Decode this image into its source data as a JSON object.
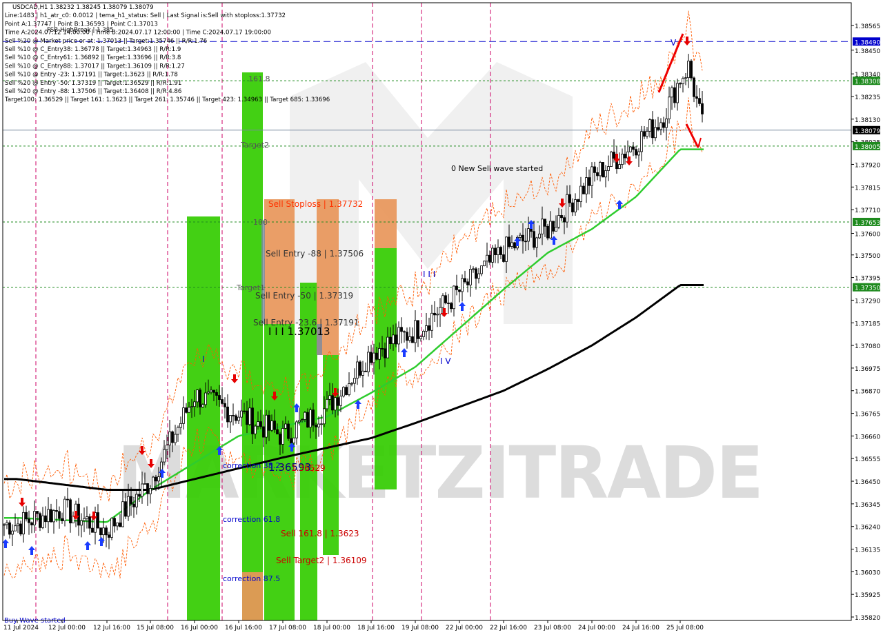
{
  "header_lines": [
    "USDCAD,H1  1.38232 1.38245 1.38079 1.38079",
    "Line:1483  |  h1_atr_c0: 0.0012  |  tema_h1_status: Sell  |  Last Signal is:Sell with stoploss:1.37732",
    "Point A:1.37747  |  Point B:1.36593  |  Point C:1.37013",
    "Time A:2024.07.12 14:00:00  |  Time B:2024.07.17 12:00:00  |  Time C:2024.07.17 19:00:00",
    "Sell %20 @ Market price or at: 1.37013  ||  Target:1.35746  ||  R/R:1.76",
    "Sell %10 @ C_Entry38: 1.36778  ||  Target:1.34963  ||  R/R:1.9",
    "Sell %10 @ C_Entry61: 1.36892  ||  Target:1.33696  ||  R/R:3.8",
    "Sell %10 @ C_Entry88: 1.37017  ||  Target:1.36109  ||  R/R:1.27",
    "Sell %10 @ Entry -23: 1.37191  ||  Target:1.3623  ||  R/R:1.78",
    "Sell %20 @ Entry -50: 1.37319  ||  Target:1.36529  ||  R/R:1.91",
    "Sell %20 @ Entry -88: 1.37506  ||  Target:1.36408  ||  R/R:4.86",
    "Target100: 1.36529  ||  Target 161: 1.3623  ||  Target 261: 1.35746  ||  Target 423: 1.34963  ||  Target 685: 1.33696"
  ],
  "overlay_label": "FSB-HighBreak | 1.385",
  "colors": {
    "background": "#ffffff",
    "bull_candle": "#000000",
    "bear_candle": "#000000",
    "ma_fast": "#2ecc2e",
    "ma_slow": "#000000",
    "band": "#ff5a00",
    "level_green": "#1e8a1e",
    "level_blue": "#0000cc",
    "vline": "#cc0066",
    "zone_green": "#33cc00",
    "zone_orange": "#e8965a",
    "arrow_up": "#1a3cff",
    "arrow_down": "#e60000"
  },
  "chart_data": {
    "type": "candlestick",
    "symbol": "USDCAD",
    "timeframe": "H1",
    "ohlc_last": {
      "open": 1.38232,
      "high": 1.38245,
      "low": 1.38079,
      "close": 1.38079
    },
    "y_range": [
      1.3582,
      1.3859
    ],
    "y_ticks": [
      1.38565,
      1.3845,
      1.3834,
      1.38235,
      1.3813,
      1.38025,
      1.3792,
      1.37815,
      1.3771,
      1.376,
      1.375,
      1.37395,
      1.3729,
      1.37185,
      1.3708,
      1.36975,
      1.3687,
      1.36765,
      1.3666,
      1.36555,
      1.3645,
      1.36345,
      1.3624,
      1.36135,
      1.3603,
      1.35925,
      1.3582
    ],
    "x_labels": [
      "11 Jul 2024",
      "12 Jul 00:00",
      "12 Jul 16:00",
      "15 Jul 08:00",
      "16 Jul 00:00",
      "16 Jul 16:00",
      "17 Jul 08:00",
      "18 Jul 00:00",
      "18 Jul 16:00",
      "19 Jul 08:00",
      "22 Jul 00:00",
      "22 Jul 16:00",
      "23 Jul 08:00",
      "24 Jul 00:00",
      "24 Jul 16:00",
      "25 Jul 08:00"
    ],
    "horizontal_levels": [
      {
        "value": 1.3849,
        "label": "1.38490",
        "style": "dashed",
        "color": "blue"
      },
      {
        "value": 1.38308,
        "label": "1.38308",
        "style": "dotted",
        "color": "green"
      },
      {
        "value": 1.38079,
        "label": "1.38079",
        "style": "solid",
        "color": "gray"
      },
      {
        "value": 1.38005,
        "label": "1.38005",
        "style": "dotted",
        "color": "green"
      },
      {
        "value": 1.37653,
        "label": "1.37653",
        "style": "dotted",
        "color": "green"
      },
      {
        "value": 1.3735,
        "label": "1.37350",
        "style": "dotted",
        "color": "green"
      }
    ],
    "annotations": [
      {
        "text": "0 New Sell wave started",
        "color": "#000000"
      },
      {
        "text": "Sell Stoploss | 1.37732",
        "color": "#ff3300"
      },
      {
        "text": "Sell Entry -88 | 1.37506",
        "color": "#333333"
      },
      {
        "text": "Sell Entry -50 | 1.37319",
        "color": "#333333"
      },
      {
        "text": "Sell Entry -23.6 | 1.37191",
        "color": "#333333"
      },
      {
        "text": "I I I 1.37013",
        "color": "#000000"
      },
      {
        "text": "1.36593",
        "color": "#000080"
      },
      {
        "text": "correction 38.2",
        "color": "#0000cc"
      },
      {
        "text": "1.36529",
        "color": "#cc0000"
      },
      {
        "text": "correction 61.8",
        "color": "#0000cc"
      },
      {
        "text": "Sell 161.8 | 1.3623",
        "color": "#cc0000"
      },
      {
        "text": "Sell Target2 | 1.36109",
        "color": "#cc0000"
      },
      {
        "text": "correction 87.5",
        "color": "#0000cc"
      },
      {
        "text": "161.8",
        "color": "#555555"
      },
      {
        "text": "100",
        "color": "#555555"
      },
      {
        "text": "Target2",
        "color": "#555555"
      },
      {
        "text": "Target1",
        "color": "#555555"
      },
      {
        "text": "I I I",
        "color": "#0000cc"
      },
      {
        "text": "I V",
        "color": "#0000cc"
      },
      {
        "text": "V",
        "color": "#0000cc"
      },
      {
        "text": "I",
        "color": "#0000cc"
      },
      {
        "text": "Buy Wave started",
        "color": "#0000cc"
      }
    ],
    "watermark": "MARKETZITRADE",
    "price_anchor_points": [
      {
        "x": "11 Jul 2024",
        "y": 1.3625
      },
      {
        "x": "12 Jul 00:00",
        "y": 1.3632
      },
      {
        "x": "12 Jul 16:00",
        "y": 1.3622
      },
      {
        "x": "15 Jul 08:00",
        "y": 1.3645
      },
      {
        "x": "16 Jul 00:00",
        "y": 1.3685
      },
      {
        "x": "16 Jul 16:00",
        "y": 1.3676
      },
      {
        "x": "17 Jul 08:00",
        "y": 1.3666
      },
      {
        "x": "18 Jul 00:00",
        "y": 1.3679
      },
      {
        "x": "18 Jul 16:00",
        "y": 1.3705
      },
      {
        "x": "19 Jul 08:00",
        "y": 1.3715
      },
      {
        "x": "22 Jul 00:00",
        "y": 1.3733
      },
      {
        "x": "22 Jul 16:00",
        "y": 1.3752
      },
      {
        "x": "23 Jul 08:00",
        "y": 1.3762
      },
      {
        "x": "24 Jul 00:00",
        "y": 1.3786
      },
      {
        "x": "24 Jul 16:00",
        "y": 1.3802
      },
      {
        "x": "25 Jul 08:00",
        "y": 1.3821
      }
    ],
    "ma_fast_anchors": [
      {
        "x": "11 Jul 2024",
        "y": 1.3628
      },
      {
        "x": "12 Jul 16:00",
        "y": 1.3626
      },
      {
        "x": "15 Jul 08:00",
        "y": 1.3641
      },
      {
        "x": "16 Jul 16:00",
        "y": 1.3666
      },
      {
        "x": "18 Jul 00:00",
        "y": 1.3675
      },
      {
        "x": "18 Jul 16:00",
        "y": 1.3686
      },
      {
        "x": "19 Jul 08:00",
        "y": 1.3698
      },
      {
        "x": "22 Jul 00:00",
        "y": 1.3716
      },
      {
        "x": "22 Jul 16:00",
        "y": 1.3734
      },
      {
        "x": "23 Jul 08:00",
        "y": 1.3751
      },
      {
        "x": "24 Jul 00:00",
        "y": 1.3762
      },
      {
        "x": "24 Jul 16:00",
        "y": 1.3777
      },
      {
        "x": "25 Jul 08:00",
        "y": 1.3799
      }
    ],
    "ma_slow_anchors": [
      {
        "x": "11 Jul 2024",
        "y": 1.3646
      },
      {
        "x": "12 Jul 16:00",
        "y": 1.3641
      },
      {
        "x": "15 Jul 08:00",
        "y": 1.3641
      },
      {
        "x": "16 Jul 16:00",
        "y": 1.3651
      },
      {
        "x": "17 Jul 08:00",
        "y": 1.3656
      },
      {
        "x": "18 Jul 16:00",
        "y": 1.3665
      },
      {
        "x": "19 Jul 08:00",
        "y": 1.3672
      },
      {
        "x": "22 Jul 16:00",
        "y": 1.3687
      },
      {
        "x": "23 Jul 08:00",
        "y": 1.3697
      },
      {
        "x": "24 Jul 00:00",
        "y": 1.3708
      },
      {
        "x": "24 Jul 16:00",
        "y": 1.3721
      },
      {
        "x": "25 Jul 08:00",
        "y": 1.3736
      }
    ]
  }
}
